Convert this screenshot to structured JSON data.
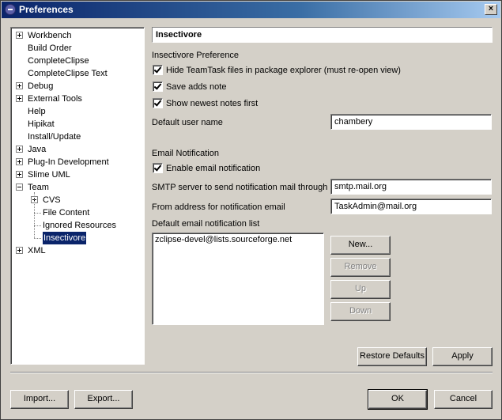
{
  "window": {
    "title": "Preferences",
    "close_glyph": "×"
  },
  "tree": [
    {
      "label": "Workbench",
      "expander": "plus",
      "level": 0
    },
    {
      "label": "Build Order",
      "expander": "none",
      "level": 0
    },
    {
      "label": "CompleteClipse",
      "expander": "none",
      "level": 0
    },
    {
      "label": "CompleteClipse Text",
      "expander": "none",
      "level": 0
    },
    {
      "label": "Debug",
      "expander": "plus",
      "level": 0
    },
    {
      "label": "External Tools",
      "expander": "plus",
      "level": 0
    },
    {
      "label": "Help",
      "expander": "none",
      "level": 0
    },
    {
      "label": "Hipikat",
      "expander": "none",
      "level": 0
    },
    {
      "label": "Install/Update",
      "expander": "none",
      "level": 0
    },
    {
      "label": "Java",
      "expander": "plus",
      "level": 0
    },
    {
      "label": "Plug-In Development",
      "expander": "plus",
      "level": 0
    },
    {
      "label": "Slime UML",
      "expander": "plus",
      "level": 0
    },
    {
      "label": "Team",
      "expander": "minus",
      "level": 0
    },
    {
      "label": "CVS",
      "expander": "plus",
      "level": 1
    },
    {
      "label": "File Content",
      "expander": "none",
      "level": 1
    },
    {
      "label": "Ignored Resources",
      "expander": "none",
      "level": 1
    },
    {
      "label": "Insectivore",
      "expander": "none",
      "level": 1,
      "selected": true
    },
    {
      "label": "XML",
      "expander": "plus",
      "level": 0
    }
  ],
  "page": {
    "title": "Insectivore",
    "section_pref": "Insectivore Preference",
    "checkboxes": [
      {
        "label": "Hide TeamTask files in package explorer (must re-open view)",
        "checked": true
      },
      {
        "label": "Save adds note",
        "checked": true
      },
      {
        "label": "Show newest notes first",
        "checked": true
      }
    ],
    "default_user_label": "Default user name",
    "default_user_value": "chambery",
    "section_email": "Email Notification",
    "enable_email": {
      "label": "Enable email notification",
      "checked": true
    },
    "smtp_label": "SMTP server to send notification mail through",
    "smtp_value": "smtp.mail.org",
    "from_label": "From address for notification email",
    "from_value": "TaskAdmin@mail.org",
    "list_label": "Default email notification list",
    "list_items": [
      "zclipse-devel@lists.sourceforge.net"
    ],
    "list_buttons": {
      "new": "New...",
      "remove": "Remove",
      "up": "Up",
      "down": "Down"
    },
    "restore_defaults": "Restore Defaults",
    "apply": "Apply"
  },
  "footer": {
    "import": "Import...",
    "export": "Export...",
    "ok": "OK",
    "cancel": "Cancel"
  }
}
